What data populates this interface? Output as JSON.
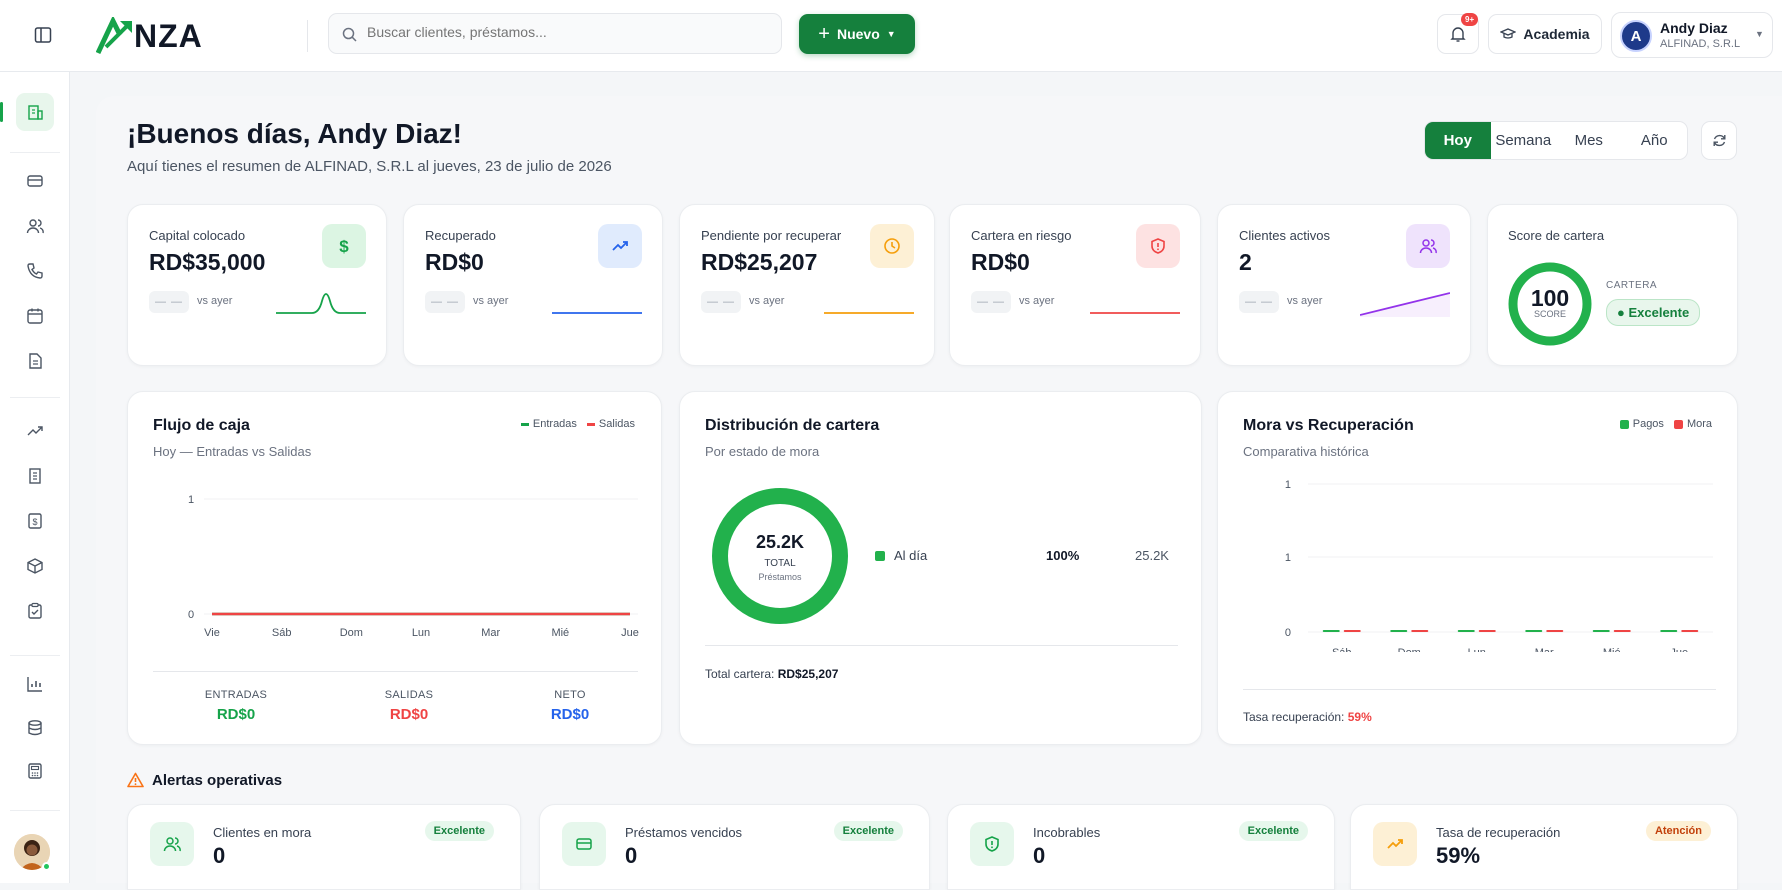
{
  "header": {
    "logo": "NZA",
    "search_placeholder": "Buscar clientes, préstamos...",
    "new_button": "Nuevo",
    "notification_count": "9+",
    "academy_label": "Academia",
    "user": {
      "name": "Andy Diaz",
      "org": "ALFINAD, S.R.L"
    }
  },
  "greeting": {
    "title": "¡Buenos días, Andy Diaz!",
    "subtitle": "Aquí tienes el resumen de ALFINAD, S.R.L al jueves, 23 de julio de 2026"
  },
  "period_tabs": [
    "Hoy",
    "Semana",
    "Mes",
    "Año"
  ],
  "active_period": "Hoy",
  "kpis": [
    {
      "label": "Capital colocado",
      "value": "RD$35,000",
      "chip": "— —",
      "vs": "vs ayer",
      "icon": "dollar-icon",
      "color": "#16a34a"
    },
    {
      "label": "Recuperado",
      "value": "RD$0",
      "chip": "— —",
      "vs": "vs ayer",
      "icon": "trending-up-icon",
      "color": "#2563eb"
    },
    {
      "label": "Pendiente por recuperar",
      "value": "RD$25,207",
      "chip": "— —",
      "vs": "vs ayer",
      "icon": "clock-icon",
      "color": "#f59e0b"
    },
    {
      "label": "Cartera en riesgo",
      "value": "RD$0",
      "chip": "— —",
      "vs": "vs ayer",
      "icon": "shield-alert-icon",
      "color": "#ef4444"
    },
    {
      "label": "Clientes activos",
      "value": "2",
      "chip": "— —",
      "vs": "vs ayer",
      "icon": "users-icon",
      "color": "#9333ea"
    }
  ],
  "score": {
    "label": "Score de cartera",
    "value": "100",
    "unit": "SCORE",
    "caption": "CARTERA",
    "badge": "Excelente"
  },
  "cashflow": {
    "title": "Flujo de caja",
    "subtitle": "Hoy — Entradas vs Salidas",
    "legend": [
      "Entradas",
      "Salidas"
    ],
    "summary": [
      {
        "label": "ENTRADAS",
        "value": "RD$0",
        "color": "#16a34a"
      },
      {
        "label": "SALIDAS",
        "value": "RD$0",
        "color": "#ef4444"
      },
      {
        "label": "NETO",
        "value": "RD$0",
        "color": "#2563eb"
      }
    ]
  },
  "distribution": {
    "title": "Distribución de cartera",
    "subtitle": "Por estado de mora",
    "center_value": "25.2K",
    "center_label": "TOTAL",
    "center_sub": "Préstamos",
    "items": [
      {
        "label": "Al día",
        "percent": "100%",
        "amount": "25.2K",
        "color": "#22b14c"
      }
    ],
    "total_label": "Total cartera:",
    "total_value": "RD$25,207"
  },
  "mora": {
    "title": "Mora vs Recuperación",
    "subtitle": "Comparativa histórica",
    "legend": [
      "Pagos",
      "Mora"
    ],
    "rate_label": "Tasa recuperación:",
    "rate_value": "59%"
  },
  "chart_data": [
    {
      "type": "line",
      "x": [
        "Vie",
        "Sáb",
        "Dom",
        "Lun",
        "Mar",
        "Mié",
        "Jue"
      ],
      "series": [
        {
          "name": "Entradas",
          "values": [
            0,
            0,
            0,
            0,
            0,
            0,
            0
          ],
          "color": "#16a34a"
        },
        {
          "name": "Salidas",
          "values": [
            0,
            0,
            0,
            0,
            0,
            0,
            0
          ],
          "color": "#ef4444"
        }
      ],
      "yticks": [
        "1",
        "0"
      ],
      "ylim": [
        0,
        1
      ]
    },
    {
      "type": "pie",
      "categories": [
        "Al día"
      ],
      "values": [
        100
      ]
    },
    {
      "type": "bar",
      "categories": [
        "Sáb",
        "Dom",
        "Lun",
        "Mar",
        "Mié",
        "Jue"
      ],
      "series": [
        {
          "name": "Pagos",
          "values": [
            0,
            0,
            0,
            0,
            0,
            0
          ],
          "color": "#22b14c"
        },
        {
          "name": "Mora",
          "values": [
            0,
            0,
            0,
            0,
            0,
            0
          ],
          "color": "#ef4444"
        }
      ],
      "yticks": [
        "1",
        "1",
        "0"
      ],
      "ylim": [
        0,
        1
      ]
    }
  ],
  "alerts": {
    "title": "Alertas operativas",
    "items": [
      {
        "label": "Clientes en mora",
        "value": "0",
        "badge": "Excelente",
        "icon": "users-icon"
      },
      {
        "label": "Préstamos vencidos",
        "value": "0",
        "badge": "Excelente",
        "icon": "credit-card-icon"
      },
      {
        "label": "Incobrables",
        "value": "0",
        "badge": "Excelente",
        "icon": "shield-icon"
      },
      {
        "label": "Tasa de recuperación",
        "value": "59%",
        "badge": "Atención",
        "icon": "trending-up-icon"
      }
    ]
  }
}
